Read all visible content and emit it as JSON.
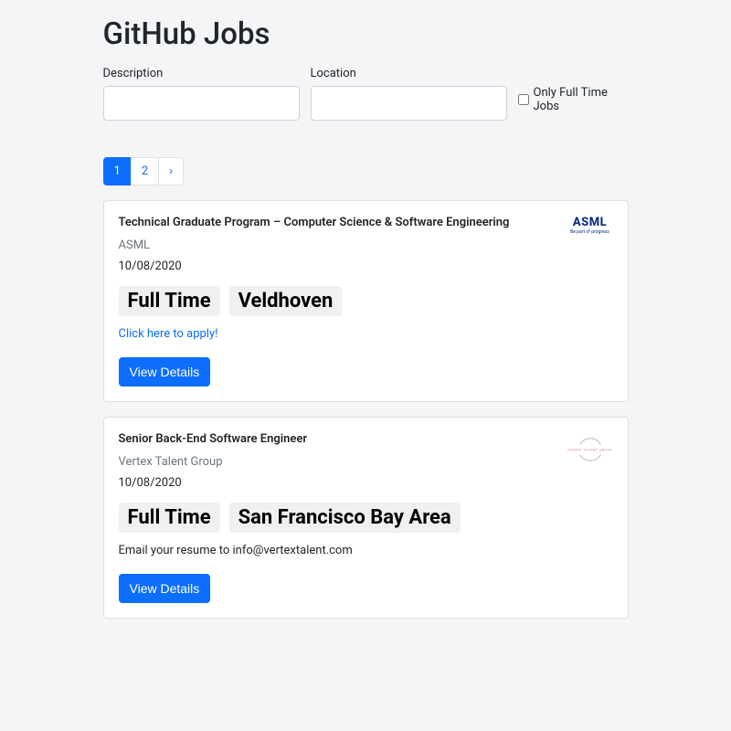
{
  "header": {
    "title": "GitHub Jobs"
  },
  "search": {
    "description_label": "Description",
    "location_label": "Location",
    "fulltime_label": "Only Full Time Jobs"
  },
  "pagination": {
    "pages": [
      "1",
      "2"
    ],
    "next_symbol": "›",
    "active": "1"
  },
  "jobs": [
    {
      "title": "Technical Graduate Program – Computer Science & Software Engineering",
      "company": "ASML",
      "date": "10/08/2020",
      "type": "Full Time",
      "location": "Veldhoven",
      "apply_text": "Click here to apply!",
      "apply_is_link": true,
      "view_details": "View Details",
      "logo": {
        "kind": "asml",
        "text": "ASML",
        "sub": "Be part of progress"
      }
    },
    {
      "title": "Senior Back-End Software Engineer",
      "company": "Vertex Talent Group",
      "date": "10/08/2020",
      "type": "Full Time",
      "location": "San Francisco Bay Area",
      "apply_text": "Email your resume to info@vertextalent.com",
      "apply_is_link": false,
      "view_details": "View Details",
      "logo": {
        "kind": "vertex",
        "text": "VERTEX TALENT GROUP"
      }
    }
  ]
}
